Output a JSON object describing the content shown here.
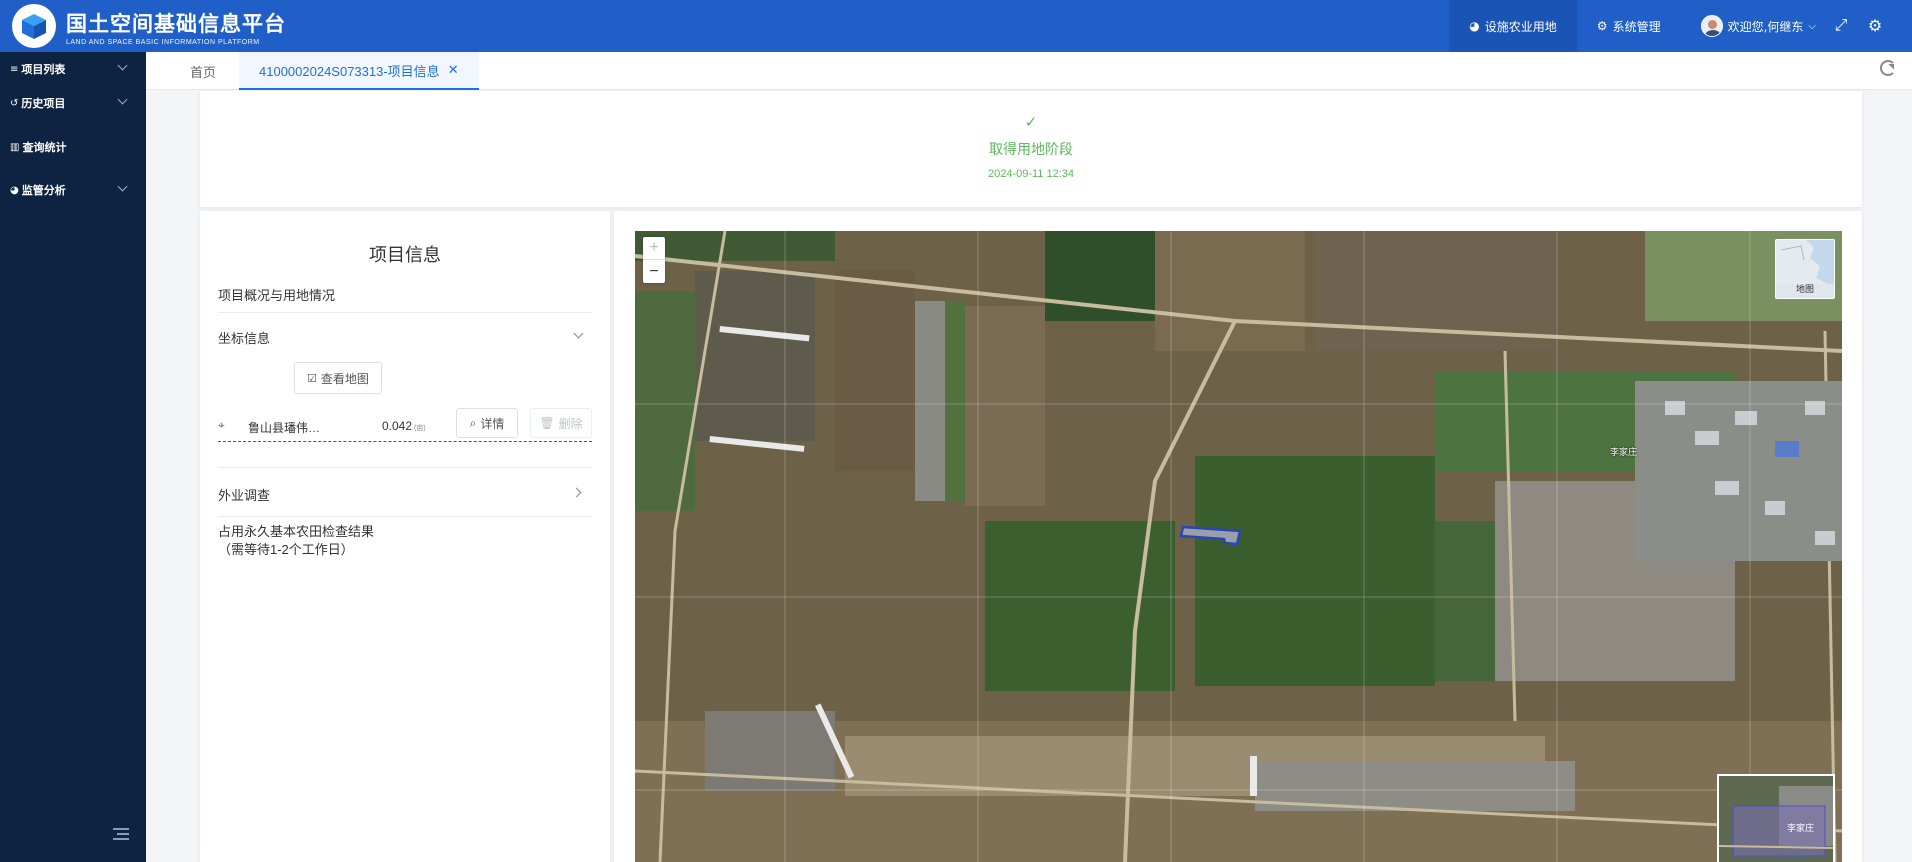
{
  "header": {
    "title": "国土空间基础信息平台",
    "subtitle": "LAND AND SPACE BASIC INFORMATION PLATFORM",
    "nav": [
      {
        "label": "设施农业用地",
        "icon": "pie-icon",
        "active": true
      },
      {
        "label": "系统管理",
        "icon": "settings-group-icon",
        "active": false
      }
    ],
    "user_greeting": "欢迎您,何继东",
    "accent": "#1f5fc7"
  },
  "sidebar": {
    "items": [
      {
        "label": "项目列表",
        "icon": "list-icon",
        "expandable": true
      },
      {
        "label": "历史项目",
        "icon": "history-icon",
        "expandable": true
      },
      {
        "label": "查询统计",
        "icon": "chart-icon",
        "expandable": false
      },
      {
        "label": "监管分析",
        "icon": "pie-icon",
        "expandable": true
      }
    ],
    "background": "#0e2341"
  },
  "tabs": {
    "home": "首页",
    "active": "4100002024S073313-项目信息"
  },
  "stage": {
    "label": "取得用地阶段",
    "time": "2024-09-11 12:34",
    "color": "#5cb85c"
  },
  "project": {
    "title": "项目信息",
    "overview_label": "项目概况与用地情况",
    "coord_label": "坐标信息",
    "view_map_button": "查看地图",
    "coord_item": {
      "name": "鲁山县璠伟…",
      "value": "0.042",
      "unit": "(亩)",
      "detail_button": "详情",
      "delete_button": "删除"
    },
    "field_survey_label": "外业调查",
    "farmland_result_label": "占用永久基本农田检查结果",
    "farmland_result_note": "（需等待1-2个工作日）"
  },
  "map": {
    "zoom_in": "+",
    "zoom_out": "−",
    "layer_label": "地图",
    "village_label": "李家庄",
    "overview_label": "李家庄"
  }
}
